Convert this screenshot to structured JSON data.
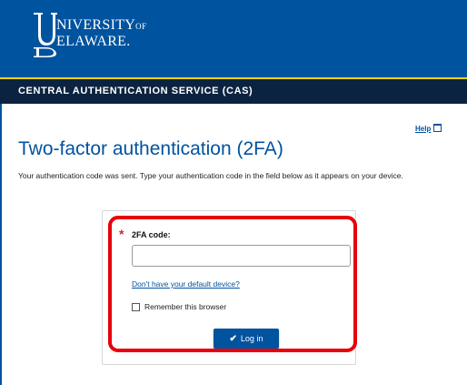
{
  "header": {
    "logo_line1": "NIVERSITY",
    "logo_line1_suffix": "OF",
    "logo_line2": "ELAWARE."
  },
  "cas_bar": {
    "title": "CENTRAL AUTHENTICATION SERVICE (CAS)"
  },
  "help": {
    "label": "Help"
  },
  "page": {
    "title": "Two-factor authentication (2FA)",
    "description": "Your authentication code was sent. Type your authentication code in the field below as it appears on your device."
  },
  "form": {
    "required_marker": "*",
    "code_label": "2FA code:",
    "code_value": "",
    "device_link": "Don't have your default device?",
    "remember_label": "Remember this browser",
    "remember_checked": false,
    "login_label": "Log in"
  },
  "colors": {
    "brand_blue": "#00539f",
    "cas_bar": "#0b2340",
    "accent_gold": "#ffd200",
    "highlight_red": "#e8000b"
  },
  "icons": [
    "ud-monogram-icon",
    "popup-window-icon",
    "checkmark-icon",
    "checkbox-icon"
  ]
}
